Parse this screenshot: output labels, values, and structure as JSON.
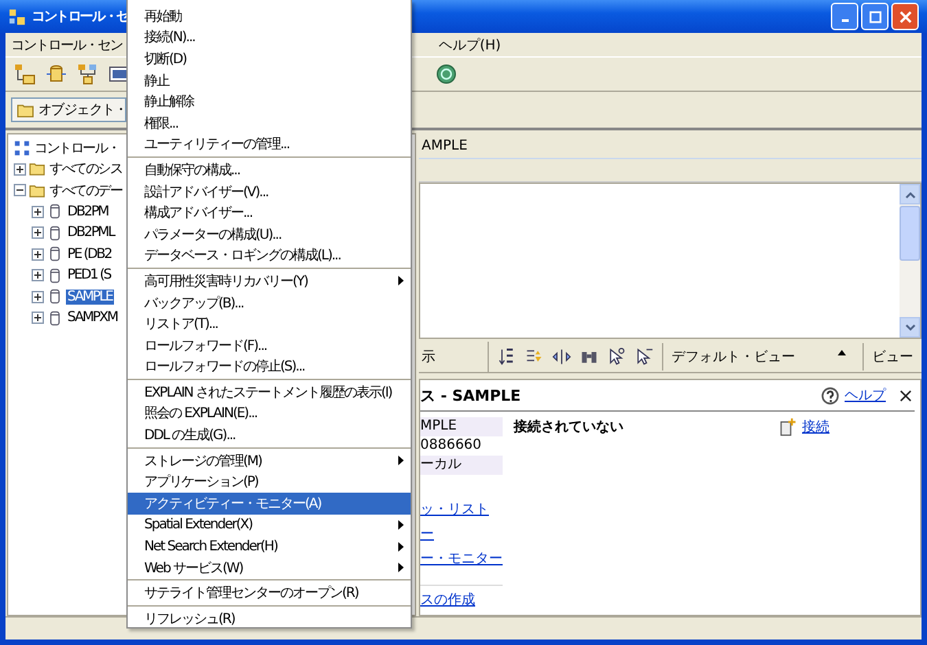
{
  "window": {
    "title": "コントロール・セ"
  },
  "menu_bar": [
    {
      "label": "コントロール・セン"
    },
    {
      "label": "ヘルプ(H)"
    }
  ],
  "object_view": {
    "label": "オブジェクト・"
  },
  "tree": [
    {
      "label": "コントロール・",
      "kind": "center",
      "selected": false,
      "children": [
        {
          "label": "すべてのシス",
          "kind": "folder",
          "expanded": false,
          "selected": false
        },
        {
          "label": "すべてのデー",
          "kind": "folder",
          "expanded": true,
          "selected": false,
          "children": [
            {
              "label": "DB2PM",
              "kind": "database",
              "expanded": false,
              "selected": false
            },
            {
              "label": "DB2PML",
              "kind": "database",
              "expanded": false,
              "selected": false
            },
            {
              "label": "PE (DB2",
              "kind": "database",
              "expanded": false,
              "selected": false
            },
            {
              "label": "PED1 (S",
              "kind": "database",
              "expanded": false,
              "selected": false
            },
            {
              "label": "SAMPLE",
              "kind": "database",
              "expanded": false,
              "selected": true
            },
            {
              "label": "SAMPXM",
              "kind": "database",
              "expanded": false,
              "selected": false
            }
          ]
        }
      ]
    }
  ],
  "object_header": "AMPLE",
  "view_toolbar": {
    "label": "示",
    "view_combo": "デフォルト・ビュー",
    "view_button": "ビュー"
  },
  "details": {
    "title": "ス - SAMPLE",
    "help": "ヘルプ",
    "fields": [
      "MPLE",
      "0886660",
      "ーカル"
    ],
    "status": "接続されていない",
    "action": "接続",
    "links": [
      "ッ・リスト",
      "ー",
      "ー・モニター"
    ],
    "bottom_link": "スの作成"
  },
  "context_menu": {
    "groups": [
      {
        "items": [
          {
            "label": "再始動",
            "submenu": false,
            "selected": false
          },
          {
            "label": "接続(N)...",
            "submenu": false,
            "selected": false
          },
          {
            "label": "切断(D)",
            "submenu": false,
            "selected": false
          },
          {
            "label": "静止",
            "submenu": false,
            "selected": false
          },
          {
            "label": "静止解除",
            "submenu": false,
            "selected": false
          },
          {
            "label": "権限...",
            "submenu": false,
            "selected": false
          },
          {
            "label": "ユーティリティーの管理...",
            "submenu": false,
            "selected": false
          }
        ]
      },
      {
        "items": [
          {
            "label": "自動保守の構成...",
            "submenu": false,
            "selected": false
          },
          {
            "label": "設計アドバイザー(V)...",
            "submenu": false,
            "selected": false
          },
          {
            "label": "構成アドバイザー...",
            "submenu": false,
            "selected": false
          },
          {
            "label": "パラメーターの構成(U)...",
            "submenu": false,
            "selected": false
          },
          {
            "label": "データベース・ロギングの構成(L)...",
            "submenu": false,
            "selected": false
          }
        ]
      },
      {
        "items": [
          {
            "label": "高可用性災害時リカバリー(Y)",
            "submenu": true,
            "selected": false
          },
          {
            "label": "バックアップ(B)...",
            "submenu": false,
            "selected": false
          },
          {
            "label": "リストア(T)...",
            "submenu": false,
            "selected": false
          },
          {
            "label": "ロールフォワード(F)...",
            "submenu": false,
            "selected": false
          },
          {
            "label": "ロールフォワードの停止(S)...",
            "submenu": false,
            "selected": false
          }
        ]
      },
      {
        "items": [
          {
            "label": "EXPLAIN されたステートメント履歴の表示(I)",
            "submenu": false,
            "selected": false
          },
          {
            "label": "照会の EXPLAIN(E)...",
            "submenu": false,
            "selected": false
          },
          {
            "label": "DDL の生成(G)...",
            "submenu": false,
            "selected": false
          }
        ]
      },
      {
        "items": [
          {
            "label": "ストレージの管理(M)",
            "submenu": true,
            "selected": false
          },
          {
            "label": "アプリケーション(P)",
            "submenu": false,
            "selected": false
          },
          {
            "label": "アクティビティー・モニター(A)",
            "submenu": false,
            "selected": true
          },
          {
            "label": "Spatial Extender(X)",
            "submenu": true,
            "selected": false
          },
          {
            "label": "Net Search Extender(H)",
            "submenu": true,
            "selected": false
          },
          {
            "label": "Web サービス(W)",
            "submenu": true,
            "selected": false
          }
        ]
      },
      {
        "items": [
          {
            "label": "サテライト管理センターのオープン(R)",
            "submenu": false,
            "selected": false
          }
        ]
      },
      {
        "items": [
          {
            "label": "リフレッシュ(R)",
            "submenu": false,
            "selected": false
          }
        ]
      }
    ]
  }
}
